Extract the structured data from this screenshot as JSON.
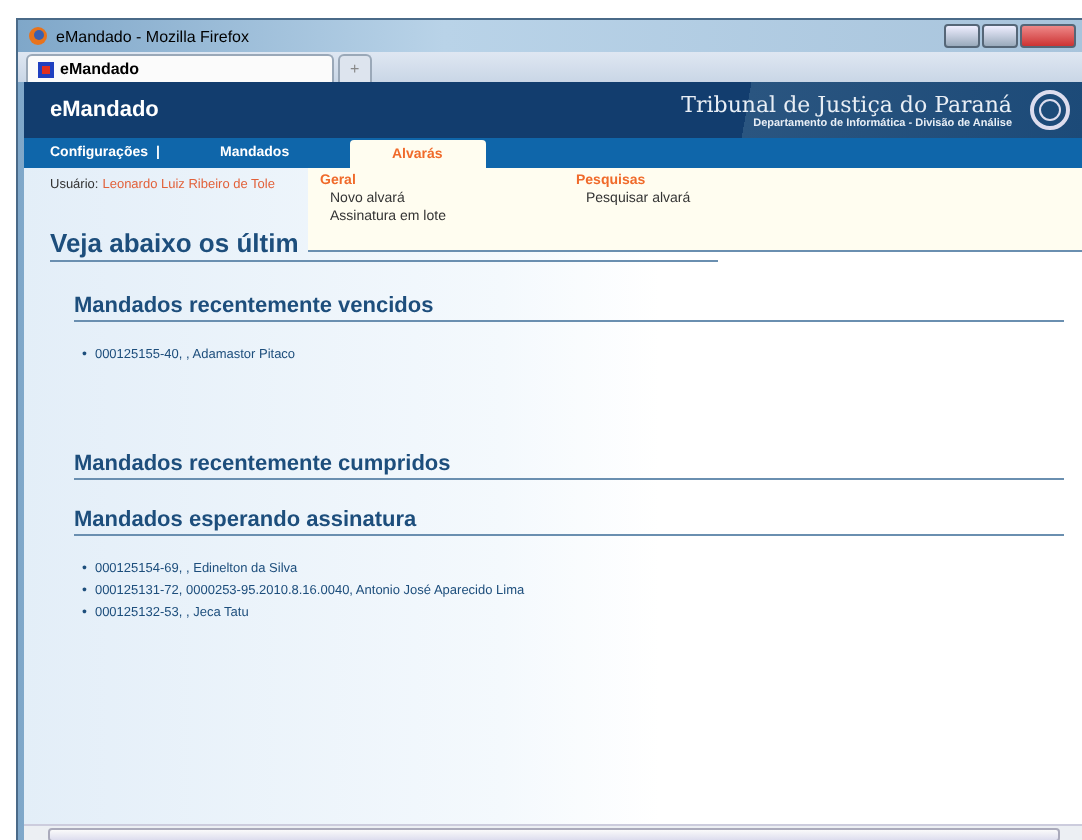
{
  "window": {
    "title": "eMandado - Mozilla Firefox"
  },
  "browser_tabs": [
    {
      "label": "eMandado",
      "selected": true
    },
    {
      "label": "+",
      "selected": false
    }
  ],
  "header": {
    "app_name": "eMandado",
    "institution": "Tribunal de Justiça do Paraná",
    "department": "Departamento de Informática - Divisão de Análise"
  },
  "nav": [
    {
      "label": "Configurações",
      "selected": false,
      "separator": "|"
    },
    {
      "label": "Mandados",
      "selected": false
    },
    {
      "label": "Alvarás",
      "selected": true
    }
  ],
  "dropdown": {
    "groups": [
      {
        "title": "Geral",
        "items": [
          "Novo alvará",
          "Assinatura em lote"
        ]
      },
      {
        "title": "Pesquisas",
        "items": [
          "Pesquisar alvará"
        ]
      }
    ]
  },
  "user": {
    "label": "Usuário:",
    "name": "Leonardo Luiz Ribeiro de Tole"
  },
  "page_title": "Veja abaixo os últim",
  "bullet": "•",
  "sections": [
    {
      "title": "Mandados recentemente vencidos",
      "items": [
        "000125155-40, , Adamastor Pitaco"
      ]
    },
    {
      "title": "Mandados recentemente cumpridos"
    },
    {
      "title": "Mandados esperando assinatura",
      "items": [
        "000125154-69, , Edinelton da Silva",
        "000125131-72, 0000253-95.2010.8.16.0040, Antonio José Aparecido Lima",
        "000125132-53, , Jeca Tatu"
      ]
    }
  ]
}
